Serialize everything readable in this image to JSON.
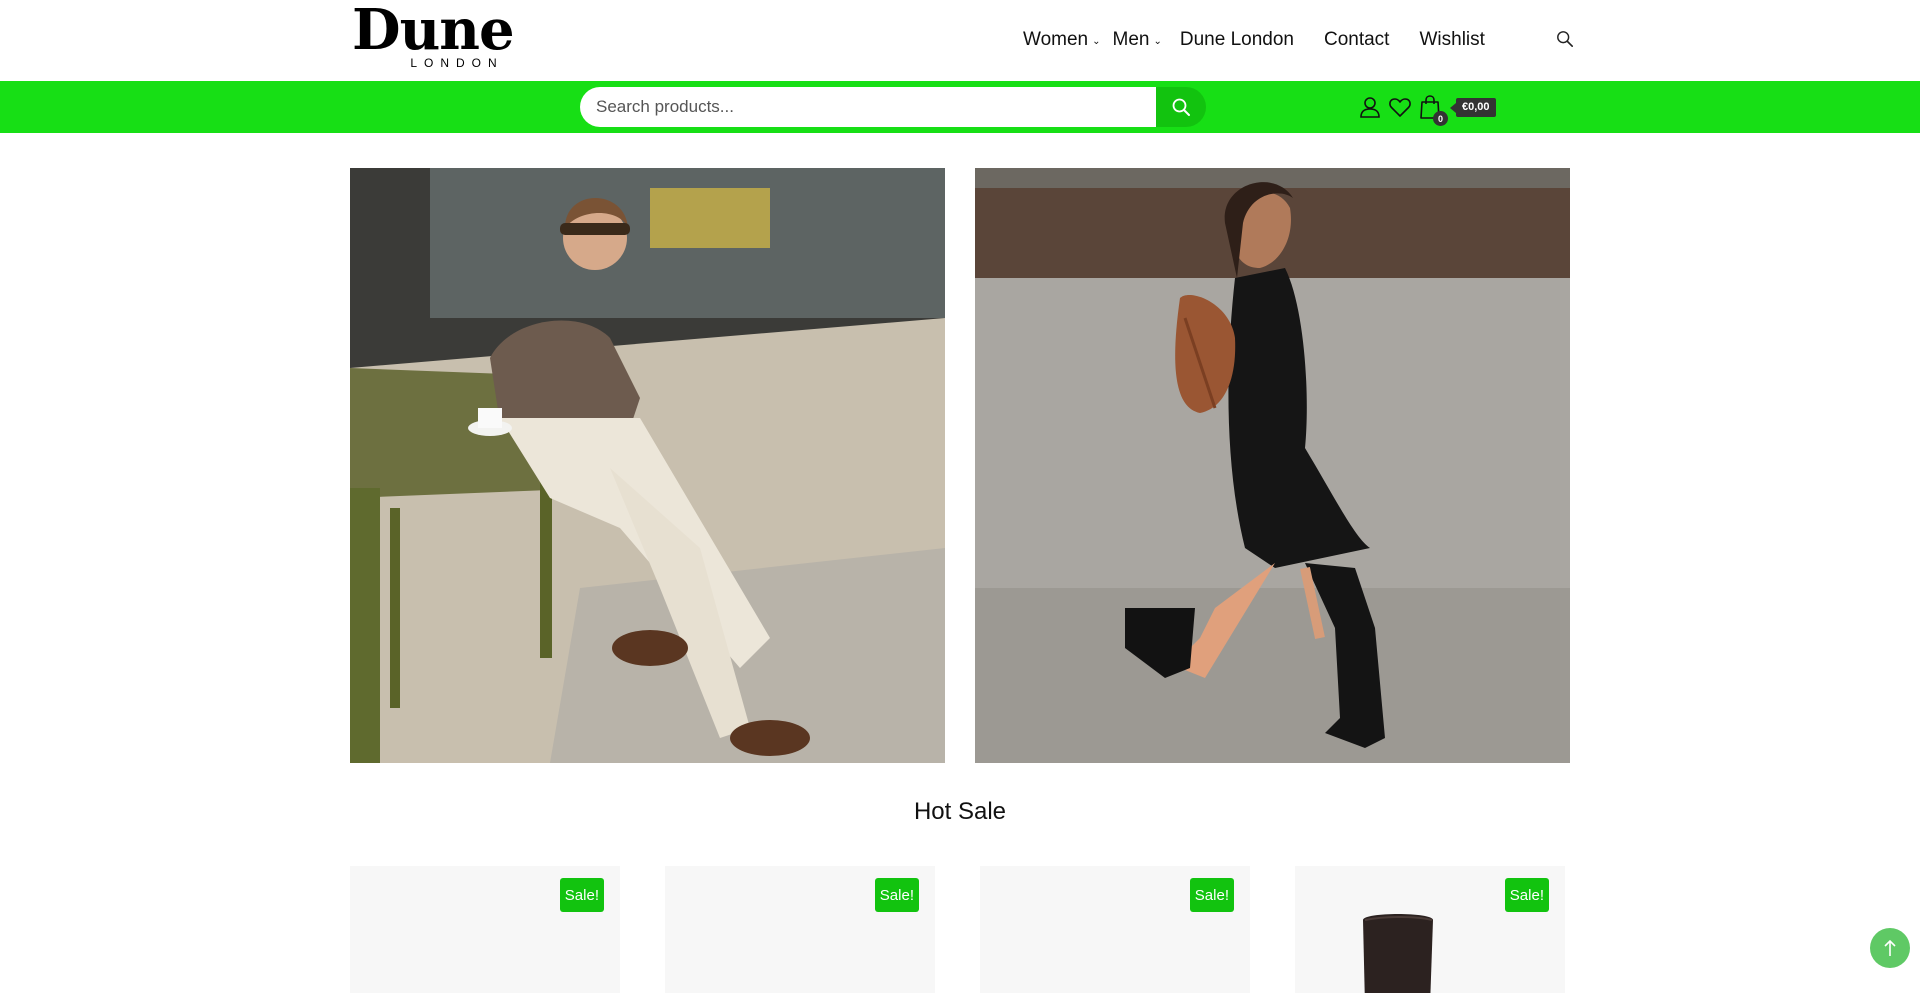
{
  "header": {
    "logo_word": "Dune",
    "logo_sub": "LONDON",
    "nav": [
      {
        "label": "Women",
        "dropdown": true
      },
      {
        "label": "Men",
        "dropdown": true
      },
      {
        "label": "Dune London",
        "dropdown": false
      },
      {
        "label": "Contact",
        "dropdown": false
      },
      {
        "label": "Wishlist",
        "dropdown": false
      }
    ],
    "search_icon": "search-icon"
  },
  "greenbar": {
    "color": "#17df15",
    "search": {
      "placeholder": "Search products...",
      "value": ""
    },
    "icons": [
      "user-icon",
      "heart-icon",
      "shopping-bag-icon"
    ],
    "cart_count": "0",
    "cart_total": "€0,00"
  },
  "banners": [
    {
      "name": "men-banner",
      "subject": "man seated at cafe table"
    },
    {
      "name": "women-banner",
      "subject": "woman walking in black dress and boots"
    }
  ],
  "hot_sale": {
    "title": "Hot Sale",
    "products": [
      {
        "badge": "Sale!"
      },
      {
        "badge": "Sale!"
      },
      {
        "badge": "Sale!"
      },
      {
        "badge": "Sale!"
      }
    ]
  },
  "colors": {
    "accent": "#17df15",
    "badge": "#12c30f",
    "back_to_top": "#5fc965"
  }
}
